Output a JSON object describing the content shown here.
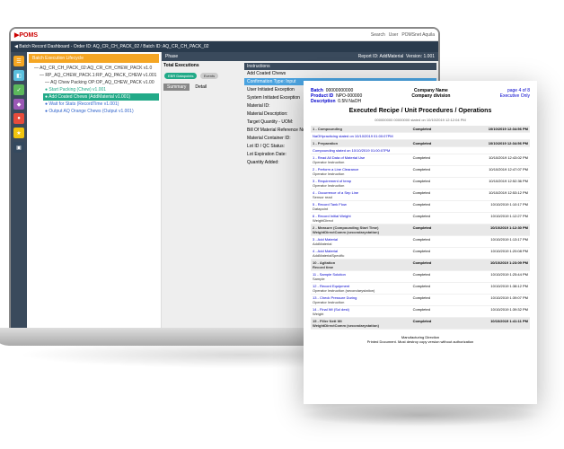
{
  "topbar": {
    "logo": "▶POMS",
    "search": "Search",
    "user": "User",
    "product": "POMSnet Aquila"
  },
  "titlebar": "Batch Record Dashboard - Order ID: AQ_CR_CH_PACK_02 / Batch ID: AQ_CR_CH_PACK_02",
  "rail": [
    {
      "color": "#f5a623",
      "icon": "☰"
    },
    {
      "color": "#5bc0de",
      "icon": "◧"
    },
    {
      "color": "#5cb85c",
      "icon": "✓"
    },
    {
      "color": "#9b59b6",
      "icon": "◆"
    },
    {
      "color": "#e74c3c",
      "icon": "●"
    },
    {
      "color": "#f1c40f",
      "icon": "★"
    },
    {
      "color": "#34495e",
      "icon": "▣"
    }
  ],
  "tree": {
    "button": "Batch Execution Lifecycle",
    "items": [
      {
        "lvl": 0,
        "cls": "",
        "text": "— AQ_CR_CH_PACK_02:AQ_CR_CH_CHEW_PACK v1.0"
      },
      {
        "lvl": 1,
        "cls": "",
        "text": "— RP_AQ_CHEW_PACK.1:RP_AQ_PACK_CHEW v1.001"
      },
      {
        "lvl": 2,
        "cls": "",
        "text": "— AQ Chew Packing OP:OP_AQ_CHEW_PACK v1.00"
      },
      {
        "lvl": 3,
        "cls": "green",
        "text": "● Start Packing (Chew) v1.001"
      },
      {
        "lvl": 3,
        "cls": "sel",
        "text": "● Add Coated Chews (AddMaterial v1.001)"
      },
      {
        "lvl": 3,
        "cls": "blue",
        "text": "● Wait for Stats (RecordTime v1.001)"
      },
      {
        "lvl": 3,
        "cls": "blue",
        "text": "● Output AQ Orange Chews (Output v1.001)"
      }
    ]
  },
  "phase": {
    "title": "Phase",
    "report": "Report ID: AddMaterial",
    "version": "Version: 1.001"
  },
  "metrics": {
    "label": "Total Executions",
    "ebr": "EBR Datapoints",
    "events": "Events",
    "summary": "Summary",
    "detail": "Detail"
  },
  "instr": {
    "header": "Instructions",
    "items": [
      {
        "cls": "",
        "text": "Add Coated Chews"
      },
      {
        "cls": "blue",
        "text": "Confirmation Type: Input"
      },
      {
        "cls": "",
        "text": "User Initiated Exception"
      },
      {
        "cls": "",
        "text": "System Initiated Exception"
      },
      {
        "cls": "",
        "text": "Material ID:"
      },
      {
        "cls": "",
        "text": "Material Description:"
      },
      {
        "cls": "",
        "text": "Target Quantity - UOM:"
      },
      {
        "cls": "",
        "text": "Bill Of Material Reference No:"
      },
      {
        "cls": "",
        "text": "Material Container ID:"
      },
      {
        "cls": "",
        "text": "Lot ID / QC Status:"
      },
      {
        "cls": "",
        "text": "Lot Expiration Date:"
      },
      {
        "cls": "",
        "text": "Quantity Added:"
      }
    ]
  },
  "doc": {
    "batch": "Batch",
    "batchVal": "00000000000",
    "product": "Product ID",
    "productVal": "NPO-000000",
    "desc": "Description",
    "descVal": "0.5N NaOH",
    "company": "Company Name",
    "division": "Company division",
    "page": "page 4 of 8",
    "ext": "Executive Only",
    "title": "Executed Recipe / Unit Procedures / Operations",
    "sub": "000000000 00000000 stated on 10/10/2019 12:12:04 PM",
    "rows": [
      {
        "section": true,
        "name": "1 - Compounding",
        "status": "Completed",
        "date": "10/10/2019 12:34:56 PM"
      },
      {
        "section": false,
        "name": "NaOHpracticing stated on 10/10/2019 01:00:07PM",
        "status": "",
        "date": ""
      },
      {
        "section": true,
        "name": "1 - Preparation",
        "status": "Completed",
        "date": "10/10/2019 12:34:56 PM"
      },
      {
        "section": false,
        "name": "Compounding stated on 10/10/2019 01:00:07PM",
        "status": "",
        "date": ""
      },
      {
        "section": false,
        "name": "1 - Read All Data of Material Use",
        "sub": "Operator Instruction",
        "status": "Completed",
        "date": "10/10/2019 12:43:02 PM"
      },
      {
        "section": false,
        "name": "2 - Perform a Line Clearance",
        "sub": "Operator Instruction",
        "status": "Completed",
        "date": "10/10/2019 12:47:07 PM"
      },
      {
        "section": false,
        "name": "3 - Requirement of temp",
        "sub": "Operator Instruction",
        "status": "Completed",
        "date": "10/10/2019 12:52:36 PM"
      },
      {
        "section": false,
        "name": "4 - Occurrence of a Sep Line",
        "sub": "Sensor read",
        "status": "Completed",
        "date": "10/10/2019 12:53:12 PM"
      },
      {
        "section": false,
        "name": "5 - Record Tank Flow",
        "sub": "Datapoint",
        "status": "Completed",
        "date": "10/10/2019 1:10:17 PM"
      },
      {
        "section": false,
        "name": "6 - Record Initial Weight",
        "sub": "WeightDirect",
        "status": "Completed",
        "date": "10/10/2019 1:12:27 PM"
      },
      {
        "section": true,
        "name": "2 - Measure (Compounding Start Time)",
        "sub": "WeightDirectComm (secondarystation)",
        "status": "Completed",
        "date": "10/10/2019 1:12:30 PM"
      },
      {
        "section": false,
        "name": "3 - Add Material",
        "sub": "AddMaterial",
        "status": "Completed",
        "date": "10/10/2019 1:13:17 PM"
      },
      {
        "section": false,
        "name": "4 - Add Material",
        "sub": "AddMaterialSpecific",
        "status": "Completed",
        "date": "10/10/2019 1:20:08 PM"
      },
      {
        "section": true,
        "name": "10 - Agitation",
        "sub": "Record time",
        "status": "Completed",
        "date": "10/10/2019 1:23:09 PM"
      },
      {
        "section": false,
        "name": "11 - Sample Solution",
        "sub": "Sample",
        "status": "Completed",
        "date": "10/10/2019 1:25:44 PM"
      },
      {
        "section": false,
        "name": "12 - Record Equipment",
        "sub": "Operator Instruction (secondarystation)",
        "status": "Completed",
        "date": "10/10/2019 1:38:12 PM"
      },
      {
        "section": false,
        "name": "13 - Check Pressure During",
        "sub": "Operator Instruction",
        "status": "Completed",
        "date": "10/10/2019 1:39:07 PM"
      },
      {
        "section": false,
        "name": "14 - Final Wt (Sol dest)",
        "sub": "Weight",
        "status": "Completed",
        "date": "10/10/2019 1:39:32 PM"
      },
      {
        "section": true,
        "name": "15 - Filler Nett Wt",
        "sub": "WeightDirectComm (secondarystation)",
        "status": "Completed",
        "date": "10/10/2019 1:41:11 PM"
      }
    ],
    "footer": "Manufacturing Direction\nPrinted Document. Must destroy copy version without authorization"
  }
}
